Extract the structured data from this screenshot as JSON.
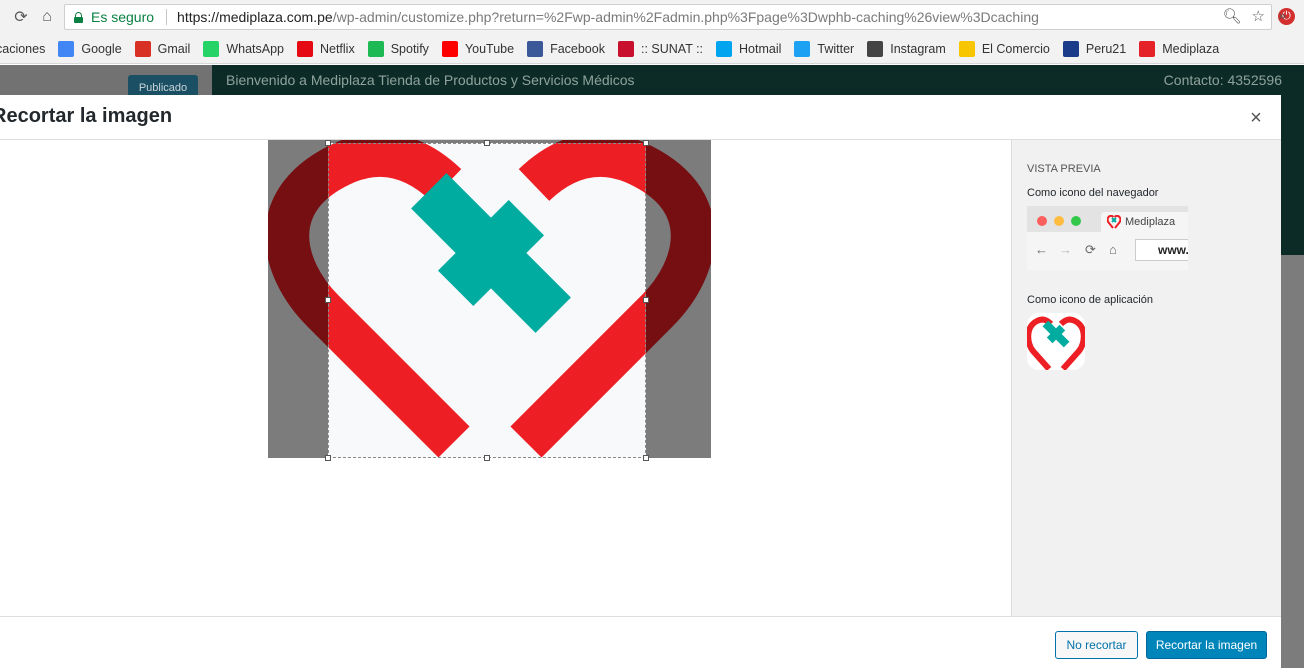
{
  "browser": {
    "secure_label": "Es seguro",
    "url_host": "https://mediplaza.com.pe",
    "url_path": "/wp-admin/customize.php?return=%2Fwp-admin%2Fadmin.php%3Fpage%3Dwphb-caching%26view%3Dcaching",
    "bookmarks": [
      {
        "label": "caciones",
        "icon": "apps-icon",
        "color": "#4285f4"
      },
      {
        "label": "Google",
        "icon": "google-icon",
        "color": "#4285f4"
      },
      {
        "label": "Gmail",
        "icon": "gmail-icon",
        "color": "#d93025"
      },
      {
        "label": "WhatsApp",
        "icon": "whatsapp-icon",
        "color": "#25d366"
      },
      {
        "label": "Netflix",
        "icon": "netflix-icon",
        "color": "#e50914"
      },
      {
        "label": "Spotify",
        "icon": "spotify-icon",
        "color": "#1db954"
      },
      {
        "label": "YouTube",
        "icon": "youtube-icon",
        "color": "#ff0000"
      },
      {
        "label": "Facebook",
        "icon": "facebook-icon",
        "color": "#3b5998"
      },
      {
        "label": ":: SUNAT ::",
        "icon": "sunat-icon",
        "color": "#c8102e"
      },
      {
        "label": "Hotmail",
        "icon": "microsoft-icon",
        "color": "#00a4ef"
      },
      {
        "label": "Twitter",
        "icon": "twitter-icon",
        "color": "#1da1f2"
      },
      {
        "label": "Instagram",
        "icon": "instagram-icon",
        "color": "#444444"
      },
      {
        "label": "El Comercio",
        "icon": "elcomercio-icon",
        "color": "#f7c600"
      },
      {
        "label": "Peru21",
        "icon": "peru21-icon",
        "color": "#1a3a8a"
      },
      {
        "label": "Mediplaza",
        "icon": "mediplaza-icon",
        "color": "#e52228"
      }
    ],
    "more_label": "»"
  },
  "wp": {
    "publish_label": "Publicado",
    "header_text": "Bienvenido a Mediplaza Tienda de Productos y Servicios Médicos",
    "contact_text": "Contacto: 4352596"
  },
  "modal": {
    "title": "Recortar la imagen",
    "close_symbol": "×",
    "preview": {
      "heading": "Vista previa",
      "browser_icon_label": "Como icono del navegador",
      "tab_title": "Mediplaza",
      "url_text": "www.",
      "app_icon_label": "Como icono de aplicación"
    },
    "buttons": {
      "skip_crop": "No recortar",
      "crop": "Recortar la imagen"
    }
  },
  "colors": {
    "logo_red": "#ed1f24",
    "logo_teal": "#00aba0",
    "primary": "#0085ba",
    "secure_green": "#0b8043"
  }
}
